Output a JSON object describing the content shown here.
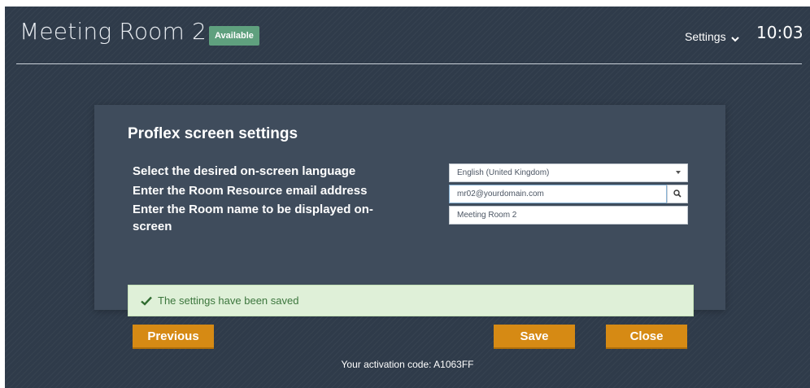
{
  "header": {
    "room_title": "Meeting Room 2",
    "status_badge": "Available",
    "settings_label": "Settings",
    "time": "10:03"
  },
  "panel": {
    "title": "Proflex screen settings",
    "fields": {
      "language": {
        "label": "Select the desired on-screen language",
        "value": "English (United Kingdom)"
      },
      "email": {
        "label": "Enter the Room Resource email address",
        "value": "mr02@yourdomain.com"
      },
      "room_name": {
        "label": "Enter the Room name to be displayed on-screen",
        "value": "Meeting Room 2"
      }
    }
  },
  "alert": {
    "message": "The settings have been saved",
    "icon": "check-icon"
  },
  "buttons": {
    "previous": "Previous",
    "save": "Save",
    "close": "Close"
  },
  "footer": {
    "activation": "Your activation code: A1063FF"
  },
  "colors": {
    "background": "#2f3b4a",
    "panel": "#3f4c5c",
    "badge": "#5fa07e",
    "button": "#d68a14",
    "success_bg": "#dff0d8",
    "success_text": "#3c763d"
  },
  "icons": {
    "settings_chevron": "chevron-down-icon",
    "email_search": "search-icon",
    "language_select": "caret-down-icon"
  }
}
